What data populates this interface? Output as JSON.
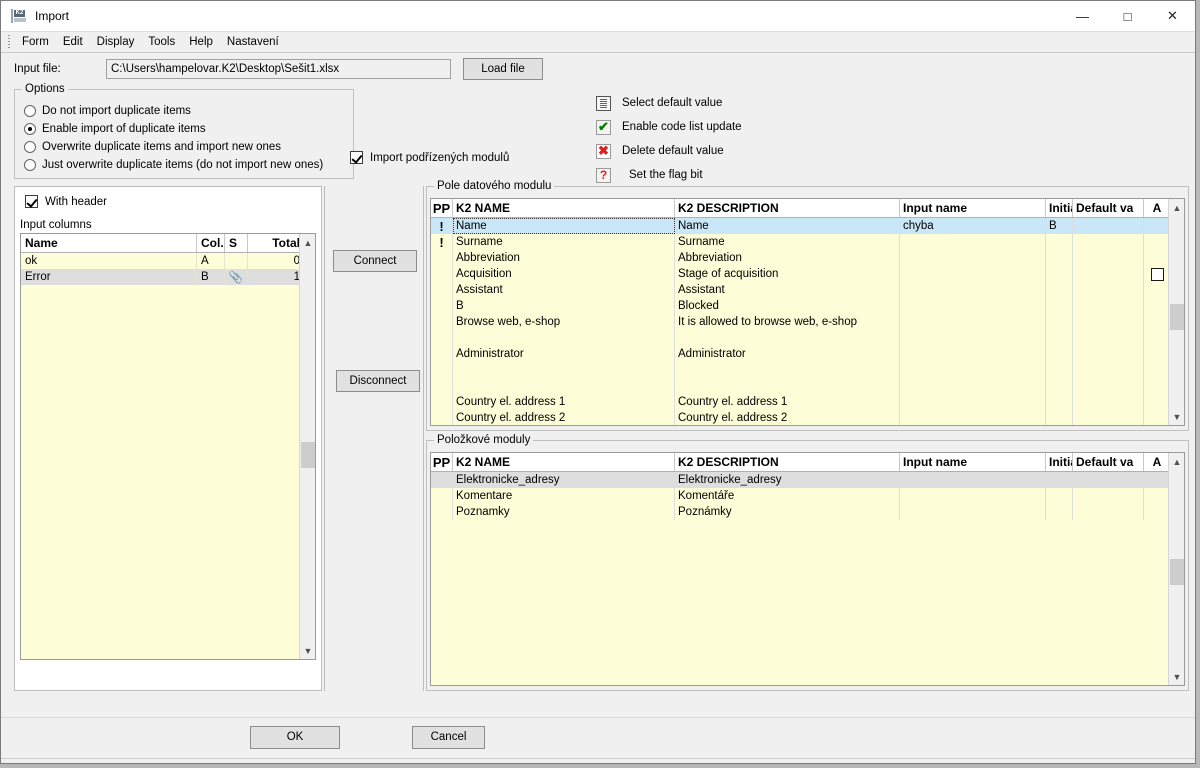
{
  "window": {
    "title": "Import",
    "icon": "k2-app-icon",
    "controls": {
      "minimize": "—",
      "maximize": "□",
      "close": "✕"
    }
  },
  "menubar": {
    "items": [
      "Form",
      "Edit",
      "Display",
      "Tools",
      "Help",
      "Nastavení"
    ]
  },
  "filerow": {
    "label": "Input file:",
    "path": "C:\\Users\\hampelovar.K2\\Desktop\\Sešit1.xlsx",
    "load_button": "Load file"
  },
  "options": {
    "title": "Options",
    "radios": [
      {
        "label": "Do not import duplicate items",
        "checked": false
      },
      {
        "label": "Enable import of duplicate items",
        "checked": true
      },
      {
        "label": "Overwrite duplicate items and import new ones",
        "checked": false
      },
      {
        "label": "Just overwrite duplicate items (do not import new ones)",
        "checked": false
      }
    ]
  },
  "import_sub": {
    "label": "Import podřízených modulů",
    "checked": true
  },
  "legend": [
    {
      "icon": "document-list-icon",
      "label": "Select default value"
    },
    {
      "icon": "green-check-icon",
      "label": "Enable code list update"
    },
    {
      "icon": "red-x-icon",
      "label": "Delete default value"
    },
    {
      "icon": "red-question-icon",
      "label": "Set the flag bit"
    }
  ],
  "left_panel": {
    "with_header": {
      "label": "With header",
      "checked": true
    },
    "input_columns_label": "Input columns",
    "grid": {
      "headers": [
        "Name",
        "Col.",
        "S",
        "Total"
      ],
      "rows": [
        {
          "name": "ok",
          "col": "A",
          "s": "",
          "total": "0",
          "selected": false
        },
        {
          "name": "Error",
          "col": "B",
          "s": "📎",
          "total": "1",
          "selected": true
        }
      ]
    }
  },
  "middle": {
    "connect_button": "Connect",
    "disconnect_button": "Disconnect"
  },
  "top_table": {
    "group_title": "Pole datového modulu",
    "headers": [
      "PP",
      "K2 NAME",
      "K2 DESCRIPTION",
      "Input name",
      "Initia",
      "Default va",
      "A"
    ],
    "rows": [
      {
        "pp": "!",
        "name": "Name",
        "desc": "Name",
        "input": "chyba",
        "init": "B",
        "defv": "",
        "a": "",
        "state": "sel-blue"
      },
      {
        "pp": "!",
        "name": "Surname",
        "desc": "Surname",
        "input": "",
        "init": "",
        "defv": "",
        "a": "",
        "state": ""
      },
      {
        "pp": "",
        "name": "Abbreviation",
        "desc": "Abbreviation",
        "input": "",
        "init": "",
        "defv": "",
        "a": "",
        "state": ""
      },
      {
        "pp": "",
        "name": "Acquisition",
        "desc": "Stage of acquisition",
        "input": "",
        "init": "",
        "defv": "",
        "a": "checkbox",
        "state": ""
      },
      {
        "pp": "",
        "name": "Assistant",
        "desc": "Assistant",
        "input": "",
        "init": "",
        "defv": "",
        "a": "",
        "state": ""
      },
      {
        "pp": "",
        "name": "B",
        "desc": "Blocked",
        "input": "",
        "init": "",
        "defv": "",
        "a": "",
        "state": ""
      },
      {
        "pp": "",
        "name": "Browse web, e-shop",
        "desc": "It is allowed to browse web, e-shop",
        "input": "",
        "init": "",
        "defv": "",
        "a": "",
        "state": ""
      },
      {
        "pp": "",
        "name": "",
        "desc": "",
        "input": "",
        "init": "",
        "defv": "",
        "a": "",
        "state": ""
      },
      {
        "pp": "",
        "name": "Administrator",
        "desc": "Administrator",
        "input": "",
        "init": "",
        "defv": "",
        "a": "",
        "state": ""
      },
      {
        "pp": "",
        "name": "",
        "desc": "",
        "input": "",
        "init": "",
        "defv": "",
        "a": "",
        "state": ""
      },
      {
        "pp": "",
        "name": "",
        "desc": "",
        "input": "",
        "init": "",
        "defv": "",
        "a": "",
        "state": ""
      },
      {
        "pp": "",
        "name": "Country el. address 1",
        "desc": "Country el. address 1",
        "input": "",
        "init": "",
        "defv": "",
        "a": "",
        "state": ""
      },
      {
        "pp": "",
        "name": "Country el. address 2",
        "desc": "Country el. address 2",
        "input": "",
        "init": "",
        "defv": "",
        "a": "",
        "state": ""
      }
    ]
  },
  "bottom_table": {
    "group_title": "Položkové moduly",
    "headers": [
      "PP",
      "K2 NAME",
      "K2 DESCRIPTION",
      "Input name",
      "Initia",
      "Default va",
      "A"
    ],
    "rows": [
      {
        "pp": "",
        "name": "Elektronicke_adresy",
        "desc": "Elektronicke_adresy",
        "input": "",
        "init": "",
        "defv": "",
        "a": "",
        "state": "sel-gray"
      },
      {
        "pp": "",
        "name": "Komentare",
        "desc": "Komentáře",
        "input": "",
        "init": "",
        "defv": "",
        "a": "",
        "state": ""
      },
      {
        "pp": "",
        "name": "Poznamky",
        "desc": "Poznámky",
        "input": "",
        "init": "",
        "defv": "",
        "a": "",
        "state": ""
      }
    ]
  },
  "footer": {
    "ok_button": "OK",
    "cancel_button": "Cancel"
  },
  "colors": {
    "grid_background": "#fdfdd8",
    "selected_row": "#c9e7f7",
    "gray_row": "#dedede",
    "alert_red": "#d40000",
    "check_green": "#008000",
    "window_chrome": "#f0f0f0"
  }
}
